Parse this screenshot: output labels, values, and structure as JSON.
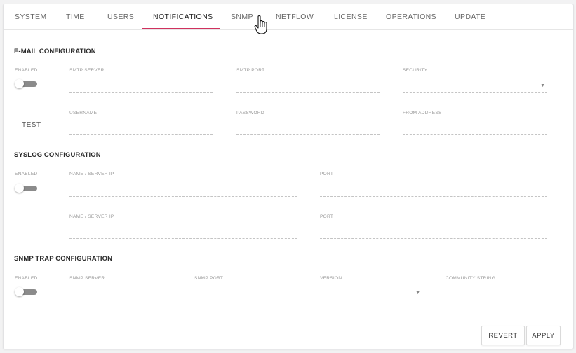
{
  "tabs": [
    {
      "label": "SYSTEM"
    },
    {
      "label": "TIME"
    },
    {
      "label": "USERS"
    },
    {
      "label": "NOTIFICATIONS",
      "active": true
    },
    {
      "label": "SNMP"
    },
    {
      "label": "NETFLOW"
    },
    {
      "label": "LICENSE"
    },
    {
      "label": "OPERATIONS"
    },
    {
      "label": "UPDATE"
    }
  ],
  "accent_color": "#d0315e",
  "email": {
    "title": "E-MAIL CONFIGURATION",
    "enabled_label": "ENABLED",
    "enabled": false,
    "smtp_server_label": "SMTP SERVER",
    "smtp_server_value": "",
    "smtp_port_label": "SMTP PORT",
    "smtp_port_value": "",
    "security_label": "SECURITY",
    "security_value": "",
    "test_label": "TEST",
    "username_label": "USERNAME",
    "username_value": "",
    "password_label": "PASSWORD",
    "password_value": "",
    "from_address_label": "FROM ADDRESS",
    "from_address_value": ""
  },
  "syslog": {
    "title": "SYSLOG CONFIGURATION",
    "enabled_label": "ENABLED",
    "enabled": false,
    "server1_label": "NAME / SERVER IP",
    "server1_value": "",
    "port1_label": "PORT",
    "port1_value": "",
    "server2_label": "NAME / SERVER IP",
    "server2_value": "",
    "port2_label": "PORT",
    "port2_value": ""
  },
  "snmp_trap": {
    "title": "SNMP TRAP CONFIGURATION",
    "enabled_label": "ENABLED",
    "enabled": false,
    "server_label": "SNMP SERVER",
    "server_value": "",
    "port_label": "SNMP PORT",
    "port_value": "",
    "version_label": "VERSION",
    "version_value": "",
    "community_label": "COMMUNITY STRING",
    "community_value": ""
  },
  "actions": {
    "revert_label": "REVERT",
    "apply_label": "APPLY"
  },
  "icons": {
    "dropdown_caret": "▼",
    "cursor": "hand-pointer-icon"
  }
}
